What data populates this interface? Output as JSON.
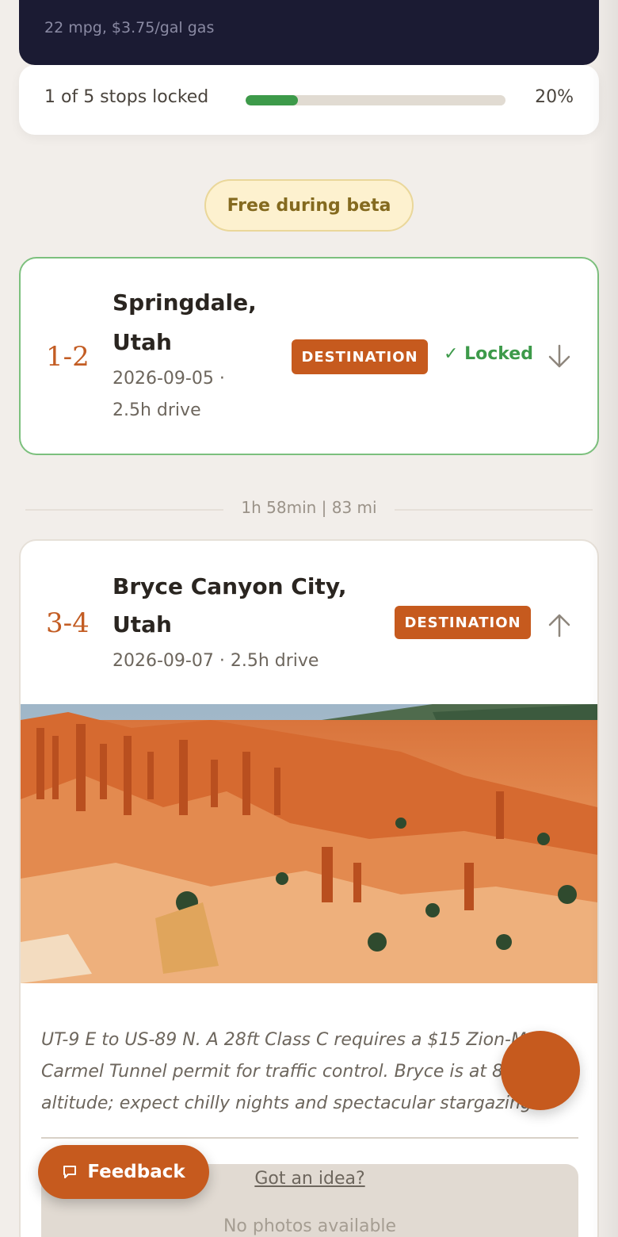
{
  "header": {
    "subtitle": "22 mpg, $3.75/gal gas"
  },
  "progress": {
    "label": "1 of 5 stops locked",
    "percent_label": "20%",
    "fraction": 0.2
  },
  "beta_badge": "Free during beta",
  "stops": [
    {
      "number": "1-2",
      "title_line1": "Springdale,",
      "title_line2": "Utah",
      "meta_line1": "2026-09-05 ·",
      "meta_line2": "2.5h drive",
      "badge": "DESTINATION",
      "status": "✓ Locked",
      "toggle_icon": "arrow-down-icon"
    },
    {
      "number": "3-4",
      "title_line1": "Bryce Canyon City,",
      "title_line2": "Utah",
      "meta": "2026-09-07 · 2.5h drive",
      "badge": "DESTINATION",
      "toggle_icon": "arrow-up-icon",
      "image": "bryce-canyon-hoodoos-photo",
      "note": "UT-9 E to US-89 N. A 28ft Class C requires a $15 Zion-Mt Carmel Tunnel permit for traffic control. Bryce is at 8,000 ft altitude; expect chilly nights and spectacular stargazing.",
      "idea_link": "Got an idea?",
      "photos_empty": "No photos available"
    }
  ],
  "leg": {
    "summary": "1h 58min | 83 mi"
  },
  "feedback": {
    "icon": "chat-icon",
    "label": "Feedback"
  },
  "colors": {
    "accent": "#c65a1e",
    "success": "#3d9a4a",
    "header_bg": "#1b1b33",
    "page_bg": "#f2eeea"
  }
}
